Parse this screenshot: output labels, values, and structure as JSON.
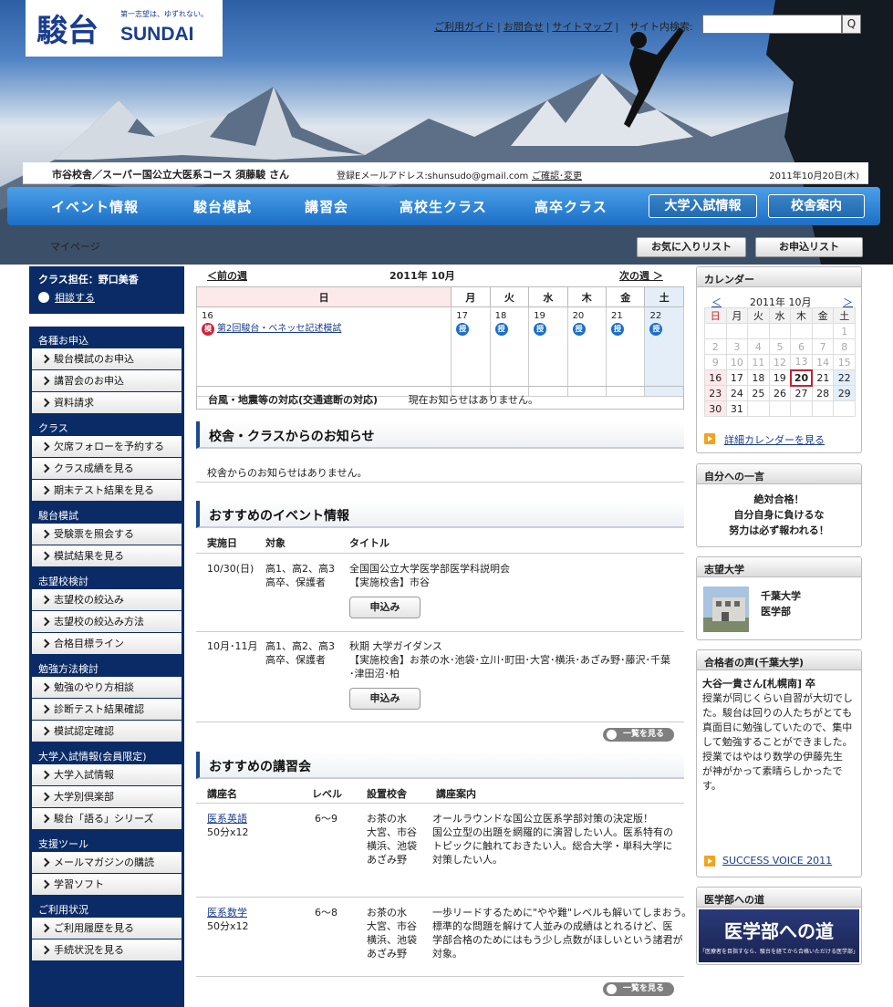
{
  "header": {
    "logo_ja": "駿台",
    "logo_en": "SUNDAI",
    "logo_tagline": "第一志望は、ゆずれない。",
    "links": [
      "ご利用ガイド",
      "お問合せ",
      "サイトマップ"
    ],
    "search_label": "サイト内検索:",
    "search_placeholder": "",
    "search_button": "Q"
  },
  "user": {
    "name_line": "市谷校舎／スーパー国公立大医系コース 須藤駿 さん",
    "email_line": "登録Eメールアドレス:shunsudo@gmail.com",
    "change_link": "ご確認･変更",
    "date": "2011年10月20日(木)"
  },
  "nav": {
    "items": [
      "イベント情報",
      "駿台模試",
      "講習会",
      "高校生クラス",
      "高卒クラス"
    ],
    "boxed": [
      "大学入試情報",
      "校舎案内"
    ]
  },
  "breadcrumb": "マイページ",
  "fav_buttons": [
    "お気に入りリスト",
    "お申込リスト"
  ],
  "sidebar": {
    "teacher_label": "クラス担任：野口美香",
    "consult_link": "相談する",
    "sections": [
      {
        "title": "各種お申込",
        "items": [
          "駿台模試のお申込",
          "講習会のお申込",
          "資料請求"
        ]
      },
      {
        "title": "クラス",
        "items": [
          "欠席フォローを予約する",
          "クラス成績を見る",
          "期末テスト結果を見る"
        ]
      },
      {
        "title": "駿台模試",
        "items": [
          "受験票を照会する",
          "模試結果を見る"
        ]
      },
      {
        "title": "志望校検討",
        "items": [
          "志望校の絞込み",
          "志望校の絞込み方法",
          "合格目標ライン"
        ]
      },
      {
        "title": "勉強方法検討",
        "items": [
          "勉強のやり方相談",
          "診断テスト結果確認",
          "模試認定確認"
        ]
      },
      {
        "title": "大学入試情報(会員限定)",
        "items": [
          "大学入試情報",
          "大学別倶楽部",
          "駿台「語る」シリーズ"
        ]
      },
      {
        "title": "支援ツール",
        "items": [
          "メールマガジンの購読",
          "学習ソフト"
        ]
      },
      {
        "title": "ご利用状況",
        "items": [
          "ご利用履歴を見る",
          "手続状況を見る"
        ]
      }
    ]
  },
  "week": {
    "prev": "＜前の週",
    "title": "2011年 10月",
    "next": "次の週 ＞",
    "days": [
      "日",
      "月",
      "火",
      "水",
      "木",
      "金",
      "土"
    ],
    "dates": [
      "16",
      "17",
      "18",
      "19",
      "20",
      "21",
      "22"
    ],
    "badge_mock": "模",
    "badge_class": "授",
    "event_link": "第2回駿台・ベネッセ記述模試"
  },
  "notice": {
    "label": "台風・地震等の対応(交通遮断の対応)",
    "text": "現在お知らせはありません。"
  },
  "school_news": {
    "title": "校舎・クラスからのお知らせ",
    "text": "校舎からのお知らせはありません。"
  },
  "events": {
    "title": "おすすめのイベント情報",
    "headers": [
      "実施日",
      "対象",
      "タイトル"
    ],
    "rows": [
      {
        "date": "10/30(日)",
        "target": [
          "高1、高2、高3",
          "高卒、保護者"
        ],
        "title": [
          "全国国公立大学医学部医学科説明会",
          "【実施校舎】市谷"
        ],
        "button": "申込み"
      },
      {
        "date": "10月･11月",
        "target": [
          "高1、高2、高3",
          "高卒、保護者"
        ],
        "title": [
          "秋期 大学ガイダンス",
          "【実施校舎】お茶の水･池袋･立川･町田･大宮･横浜･あざみ野･藤沢･千葉",
          "･津田沼･柏"
        ],
        "button": "申込み"
      }
    ],
    "more": "一覧を見る"
  },
  "courses": {
    "title": "おすすめの講習会",
    "headers": [
      "講座名",
      "レベル",
      "設置校舎",
      "講座案内"
    ],
    "rows": [
      {
        "name": "医系英語",
        "duration": "50分x12",
        "level": "6〜9",
        "schools": [
          "お茶の水",
          "大宮、市谷",
          "横浜、池袋",
          "あざみ野"
        ],
        "desc": [
          "オールラウンドな国公立医系学部対策の決定版！",
          "国公立型の出題を網羅的に演習したい人。医系特有の",
          "トピックに触れておきたい人。総合大学・単科大学に",
          "対策したい人。"
        ]
      },
      {
        "name": "医系数学",
        "duration": "50分x12",
        "level": "6〜8",
        "schools": [
          "お茶の水",
          "大宮、市谷",
          "横浜、池袋",
          "あざみ野"
        ],
        "desc": [
          "一歩リードするために\"やや難\"レベルも解いてしまおう。",
          "標準的な問題を解けて人並みの成績はとれるけど、医",
          "学部合格のためにはもう少し点数がほしいという諸君が",
          "対象。"
        ]
      }
    ],
    "more": "一覧を見る"
  },
  "calendar": {
    "title": "カレンダー",
    "prev": "＜",
    "month": "2011年 10月",
    "next": "＞",
    "days": [
      "日",
      "月",
      "火",
      "水",
      "木",
      "金",
      "土"
    ],
    "weeks": [
      [
        "",
        "",
        "",
        "",
        "",
        "",
        "1"
      ],
      [
        "2",
        "3",
        "4",
        "5",
        "6",
        "7",
        "8"
      ],
      [
        "9",
        "10",
        "11",
        "12",
        "13",
        "14",
        "15"
      ],
      [
        "16",
        "17",
        "18",
        "19",
        "20",
        "21",
        "22"
      ],
      [
        "23",
        "24",
        "25",
        "26",
        "27",
        "28",
        "29"
      ],
      [
        "30",
        "31",
        "",
        "",
        "",
        "",
        ""
      ]
    ],
    "detail_link": "詳細カレンダーを見る"
  },
  "message": {
    "title": "自分への一言",
    "lines": [
      "絶対合格！",
      "自分自身に負けるな",
      "努力は必ず報われる！"
    ]
  },
  "target_univ": {
    "title": "志望大学",
    "univ": "千葉大学",
    "faculty": "医学部"
  },
  "voice": {
    "title": "合格者の声(千葉大学)",
    "name": "大谷一貴さん[札幌南] 卒",
    "lines": [
      "授業が同じくらい自習が大切でし",
      "た。駿台は回りの人たちがとても",
      "真面目に勉強していたので、集中",
      "して勉強することができました。",
      "授業ではやはり数学の伊藤先生",
      "が神がかって素晴らしかったです。"
    ],
    "link": "SUCCESS VOICE 2011"
  },
  "road": {
    "title": "医学部への道",
    "banner": "医学部への道",
    "banner_sub": "「医療者を目指すなら、駿台を経てから合格いただける医学部」"
  },
  "colors": {
    "nav": "#1c6fc6",
    "sidebar": "#0a2b66",
    "accent": "#f4a31a",
    "sunday": "#fde8ea",
    "saturday": "#e3eef8"
  }
}
